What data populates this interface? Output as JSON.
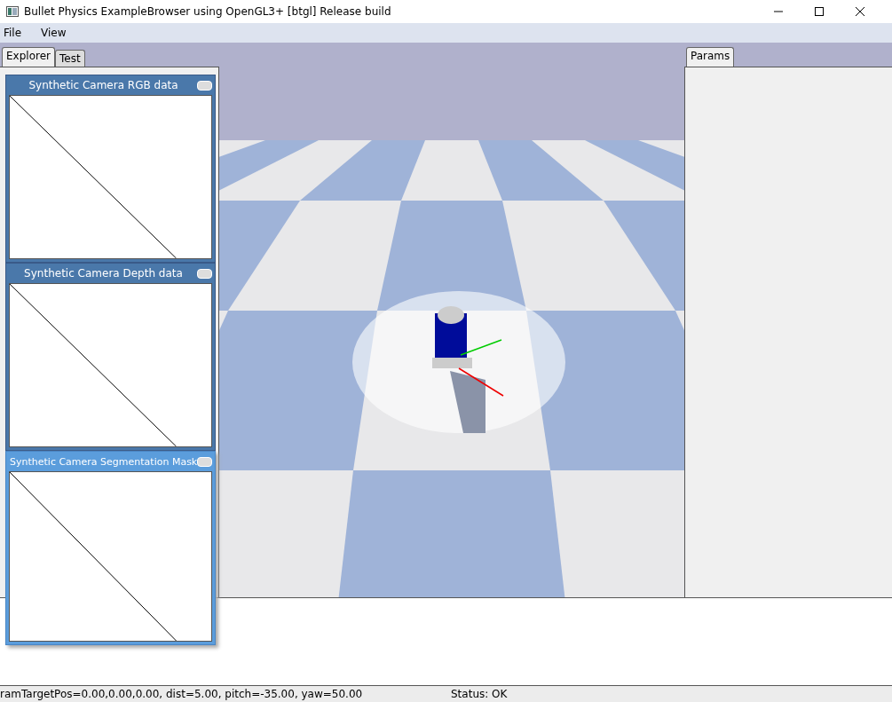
{
  "window": {
    "title": "Bullet Physics ExampleBrowser using OpenGL3+ [btgl] Release build"
  },
  "menu": [
    {
      "label": "File"
    },
    {
      "label": "View"
    }
  ],
  "left_tabs": [
    {
      "label": "Explorer",
      "selected": true
    },
    {
      "label": "Test",
      "selected": false
    }
  ],
  "camera_windows": [
    {
      "title": "Synthetic Camera RGB data",
      "active": false
    },
    {
      "title": "Synthetic Camera Depth data",
      "active": false
    },
    {
      "title": "Synthetic Camera Segmentation Mask",
      "active": true
    }
  ],
  "right_tabs": [
    {
      "label": "Params",
      "selected": true
    }
  ],
  "status_bar": {
    "camera": "ramTargetPos=0.00,0.00,0.00, dist=5.00, pitch=-35.00, yaw=50.00",
    "status": "Status: OK"
  }
}
